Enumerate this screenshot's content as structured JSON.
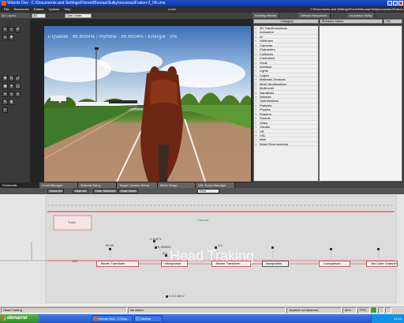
{
  "window": {
    "title": "Virtools Dev : C:\\Documents and Settings\\Florent\\Bureau\\Sulky\\nouveau\\Fusion-2_04.cmo"
  },
  "menu": {
    "items": [
      "File",
      "Resources",
      "Editors",
      "Options",
      "Help"
    ],
    "layout_title": "Level",
    "path": "C:\\Documents and Settings\\Florent\\Bureau\\Sulky\\nouveau\\Fusion-2_04.cmo"
  },
  "viewport": {
    "panel_label": "3D Layout",
    "view_select": "3D",
    "camera_select": "Cam Jouer",
    "overlay_text": "1-Qualité : 98.8004% / Rythme : 86.6004% / Energie : 0%"
  },
  "right_panel": {
    "tabs": [
      "Building Blocks",
      "Virtools Resources",
      "nouveaux Sulky"
    ],
    "category_header": "Category",
    "bb_columns": [
      "Behavior Name",
      "Ver"
    ],
    "categories": [
      "3D Transformations",
      "Animation",
      "AI",
      "Attributes",
      "Cameras",
      "Characters",
      "Collisions",
      "Controllers",
      "Grids",
      "Interface",
      "Lights",
      "Logics",
      "Materials-Textures",
      "Mesh Modifications",
      "MultiLevel",
      "Narratives",
      "Network",
      "Optimizations",
      "Particles",
      "Physics",
      "Shaders",
      "Sounds",
      "Video",
      "Visuals",
      "VR",
      "VSL",
      "Web",
      "World Environments"
    ]
  },
  "schematic": {
    "tabs": [
      "Schematic",
      "Level Manager",
      "Material Setup",
      "Target Camera Setup",
      "Mesh Setup",
      "VSL Script Manager"
    ],
    "toolbar": [
      "Show All",
      "Hide All",
      "Hide Selected",
      "Hide Other"
    ],
    "find_label": "Find",
    "script_label": "Camera",
    "nodes": [
      {
        "label": "Bezier Transform"
      },
      {
        "label": "Interpolator"
      },
      {
        "label": "Bezier Transform"
      },
      {
        "label": "Interpolator"
      },
      {
        "label": "Comparison"
      },
      {
        "label": "Set Color Channel"
      }
    ],
    "track_label": "Track",
    "ghost_label": "Head Traking",
    "params": [
      "60.40",
      "0.480654",
      "0.0",
      "2.40571",
      "0.0"
    ],
    "bottom_value": "0.113 dt/12",
    "small_labels": [
      "INC"
    ]
  },
  "status": {
    "left": "Head Traking",
    "mid": "No action",
    "right": "Joystick not attached",
    "fps_label": "FPS",
    "fps": "48.6"
  },
  "taskbar": {
    "start": "démarrer",
    "items": [
      "Virtools Dev - C:\\Doc...",
      "NeoBar"
    ],
    "clock": "14:10"
  }
}
